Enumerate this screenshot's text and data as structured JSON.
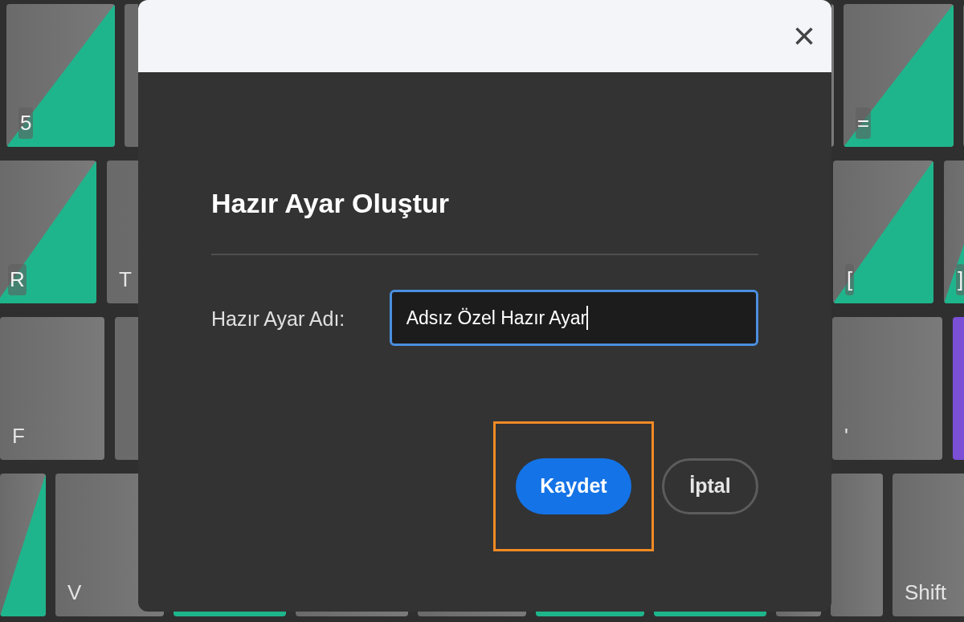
{
  "keyboard": {
    "rows": [
      [
        {
          "label": "5",
          "kind": "split",
          "color": "#1fb58c"
        },
        {
          "kind": "plain"
        },
        {
          "label": "=",
          "kind": "split",
          "color": "#1fb58c"
        },
        {
          "kind": "plain"
        }
      ],
      [
        {
          "label": "R",
          "kind": "split",
          "color": "#1fb58c"
        },
        {
          "label": "T",
          "kind": "plain"
        },
        {
          "label": "[",
          "kind": "split",
          "color": "#1fb58c"
        },
        {
          "label": "]",
          "kind": "split",
          "color": "#1fb58c"
        }
      ],
      [
        {
          "label": "F",
          "kind": "plain"
        },
        {
          "kind": "plain"
        },
        {
          "label": "'",
          "kind": "plain"
        },
        {
          "kind": "solid",
          "color": "#7b4fd6"
        }
      ],
      [
        {
          "kind": "split",
          "color": "#1fb58c"
        },
        {
          "label": "V",
          "kind": "plain"
        },
        {
          "kind": "solid",
          "color": "#1fb58c"
        },
        {
          "kind": "plain"
        },
        {
          "kind": "plain"
        },
        {
          "kind": "solid",
          "color": "#1fb58c"
        },
        {
          "kind": "solid",
          "color": "#1fb58c"
        },
        {
          "kind": "plain"
        },
        {
          "kind": "plain"
        },
        {
          "label": "Shift",
          "kind": "plain"
        }
      ]
    ]
  },
  "dialog": {
    "close": "×",
    "title": "Hazır Ayar Oluştur",
    "name_field": {
      "label": "Hazır Ayar Adı:",
      "value": "Adsız Özel Hazır Ayar",
      "focused": true
    },
    "buttons": [
      {
        "label": "Kaydet",
        "kind": "primary",
        "highlighted": true
      },
      {
        "label": "İptal",
        "kind": "secondary",
        "highlighted": false
      }
    ]
  }
}
